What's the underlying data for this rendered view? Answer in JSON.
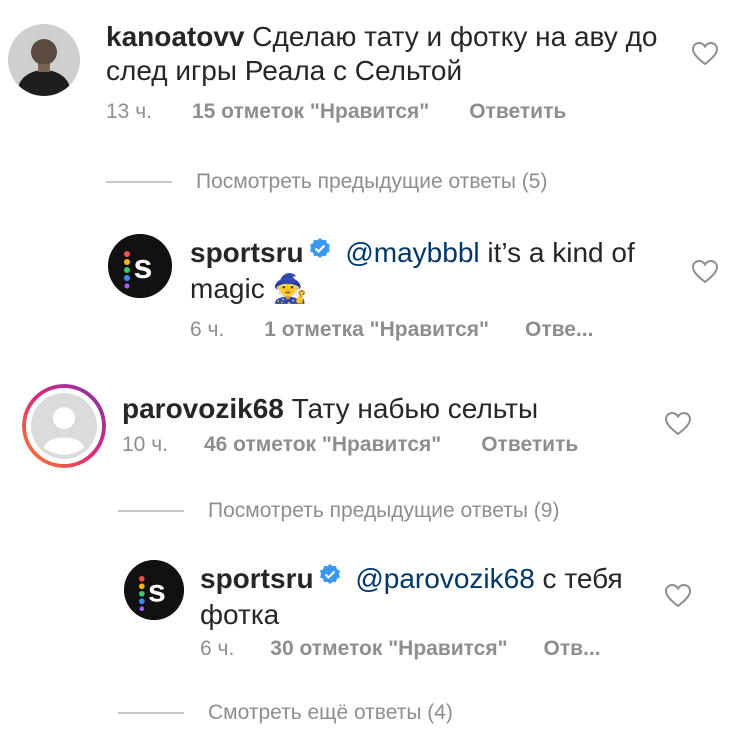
{
  "comments": [
    {
      "username": "kanoatovv",
      "text": "Сделаю тату и фотку на аву до след игры Реала с Сельтой",
      "time": "13 ч.",
      "likes": "15 отметок \"Нравится\"",
      "reply": "Ответить",
      "view_replies": "Посмотреть предыдущие ответы (5)",
      "replies": [
        {
          "username": "sportsru",
          "mention": "@maybbbl",
          "text": "it’s a kind of magic 🧙",
          "time": "6 ч.",
          "likes": "1 отметка \"Нравится\"",
          "reply": "Отве..."
        }
      ]
    },
    {
      "username": "parovozik68",
      "text": "Тату набью сельты",
      "time": "10 ч.",
      "likes": "46 отметок \"Нравится\"",
      "reply": "Ответить",
      "view_replies": "Посмотреть предыдущие ответы (9)",
      "replies": [
        {
          "username": "sportsru",
          "mention": "@parovozik68",
          "text": "с тебя фотка",
          "time": "6 ч.",
          "likes": "30 отметок \"Нравится\"",
          "reply": "Отв..."
        }
      ],
      "more_replies": "Смотреть ещё ответы (4)"
    }
  ],
  "icons": {
    "heart": "heart-icon",
    "verified": "verified-badge-icon",
    "sportsru_logo": "sportsru-logo"
  },
  "colors": {
    "text": "#262626",
    "meta": "#8e8e8e",
    "mention": "#00376b",
    "verified": "#3897f0",
    "story_ring_start": "#f58529",
    "story_ring_end": "#c13584"
  }
}
